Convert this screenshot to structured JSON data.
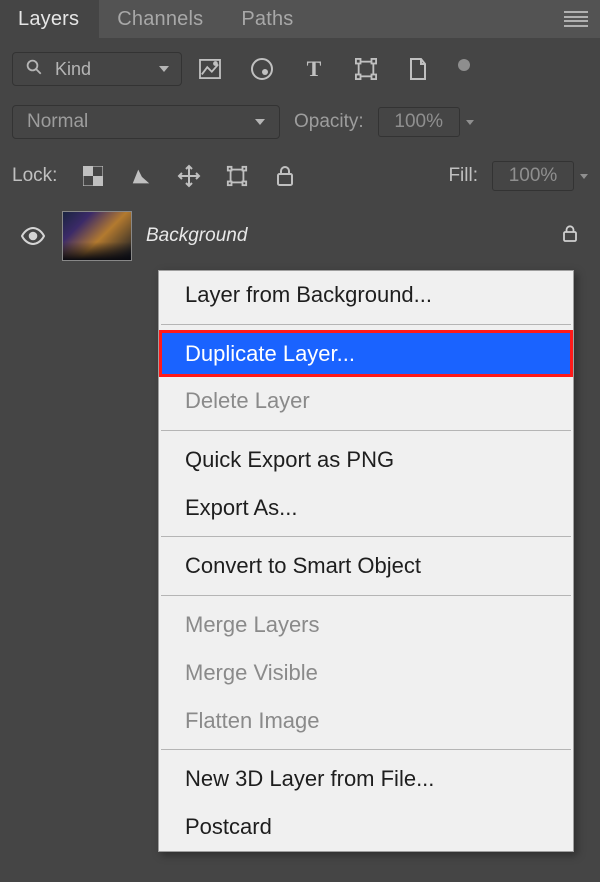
{
  "tabs": {
    "items": [
      "Layers",
      "Channels",
      "Paths"
    ],
    "active_index": 0
  },
  "filter": {
    "kind_label": "Kind"
  },
  "blend": {
    "mode": "Normal",
    "opacity_label": "Opacity:",
    "opacity_value": "100%"
  },
  "lock": {
    "label": "Lock:",
    "fill_label": "Fill:",
    "fill_value": "100%"
  },
  "layer": {
    "name": "Background"
  },
  "context_menu": {
    "groups": [
      [
        {
          "label": "Layer from Background...",
          "enabled": true
        }
      ],
      [
        {
          "label": "Duplicate Layer...",
          "enabled": true,
          "highlight": true
        },
        {
          "label": "Delete Layer",
          "enabled": false
        }
      ],
      [
        {
          "label": "Quick Export as PNG",
          "enabled": true
        },
        {
          "label": "Export As...",
          "enabled": true
        }
      ],
      [
        {
          "label": "Convert to Smart Object",
          "enabled": true
        }
      ],
      [
        {
          "label": "Merge Layers",
          "enabled": false
        },
        {
          "label": "Merge Visible",
          "enabled": false
        },
        {
          "label": "Flatten Image",
          "enabled": false
        }
      ],
      [
        {
          "label": "New 3D Layer from File...",
          "enabled": true
        },
        {
          "label": "Postcard",
          "enabled": true
        }
      ]
    ]
  }
}
